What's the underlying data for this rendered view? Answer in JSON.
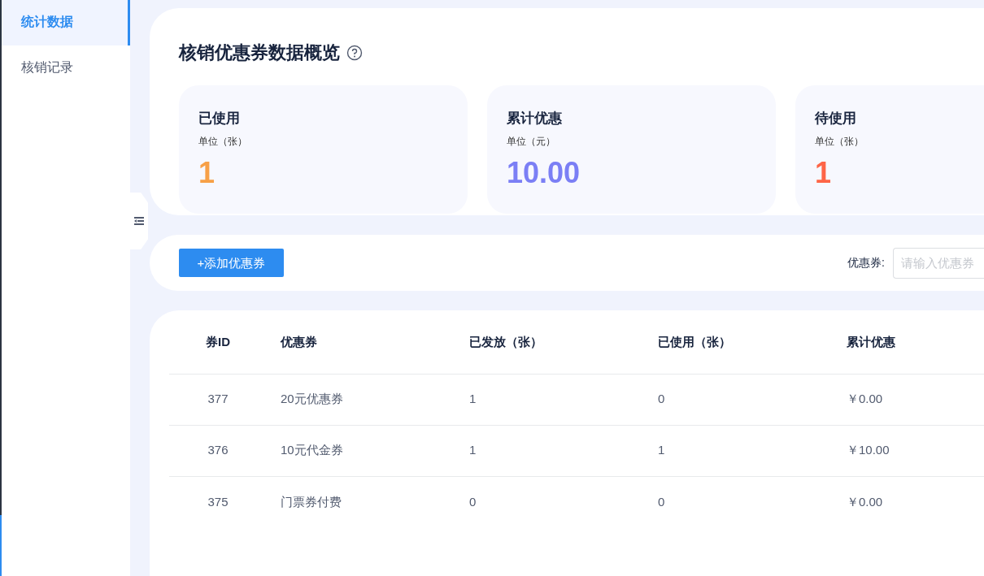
{
  "sidebar": {
    "items": [
      {
        "label": "统计数据",
        "selected": true
      },
      {
        "label": "核销记录",
        "selected": false
      }
    ]
  },
  "overview": {
    "title": "核销优惠券数据概览",
    "stats": [
      {
        "label": "已使用",
        "unit": "单位（张）",
        "value": "1",
        "color": "#f7a047"
      },
      {
        "label": "累计优惠",
        "unit": "单位（元）",
        "value": "10.00",
        "color": "#7b7ff5"
      },
      {
        "label": "待使用",
        "unit": "单位（张）",
        "value": "1",
        "color": "#fe6547"
      }
    ]
  },
  "toolbar": {
    "add_button": "+添加优惠券",
    "filter_label": "优惠券:",
    "filter_placeholder": "请输入优惠券"
  },
  "table": {
    "columns": [
      "券ID",
      "优惠券",
      "已发放（张）",
      "已使用（张）",
      "累计优惠"
    ],
    "rows": [
      [
        "377",
        "20元优惠券",
        "1",
        "0",
        "￥0.00"
      ],
      [
        "376",
        "10元代金券",
        "1",
        "1",
        "￥10.00"
      ],
      [
        "375",
        "门票券付费",
        "0",
        "0",
        "￥0.00"
      ]
    ]
  }
}
